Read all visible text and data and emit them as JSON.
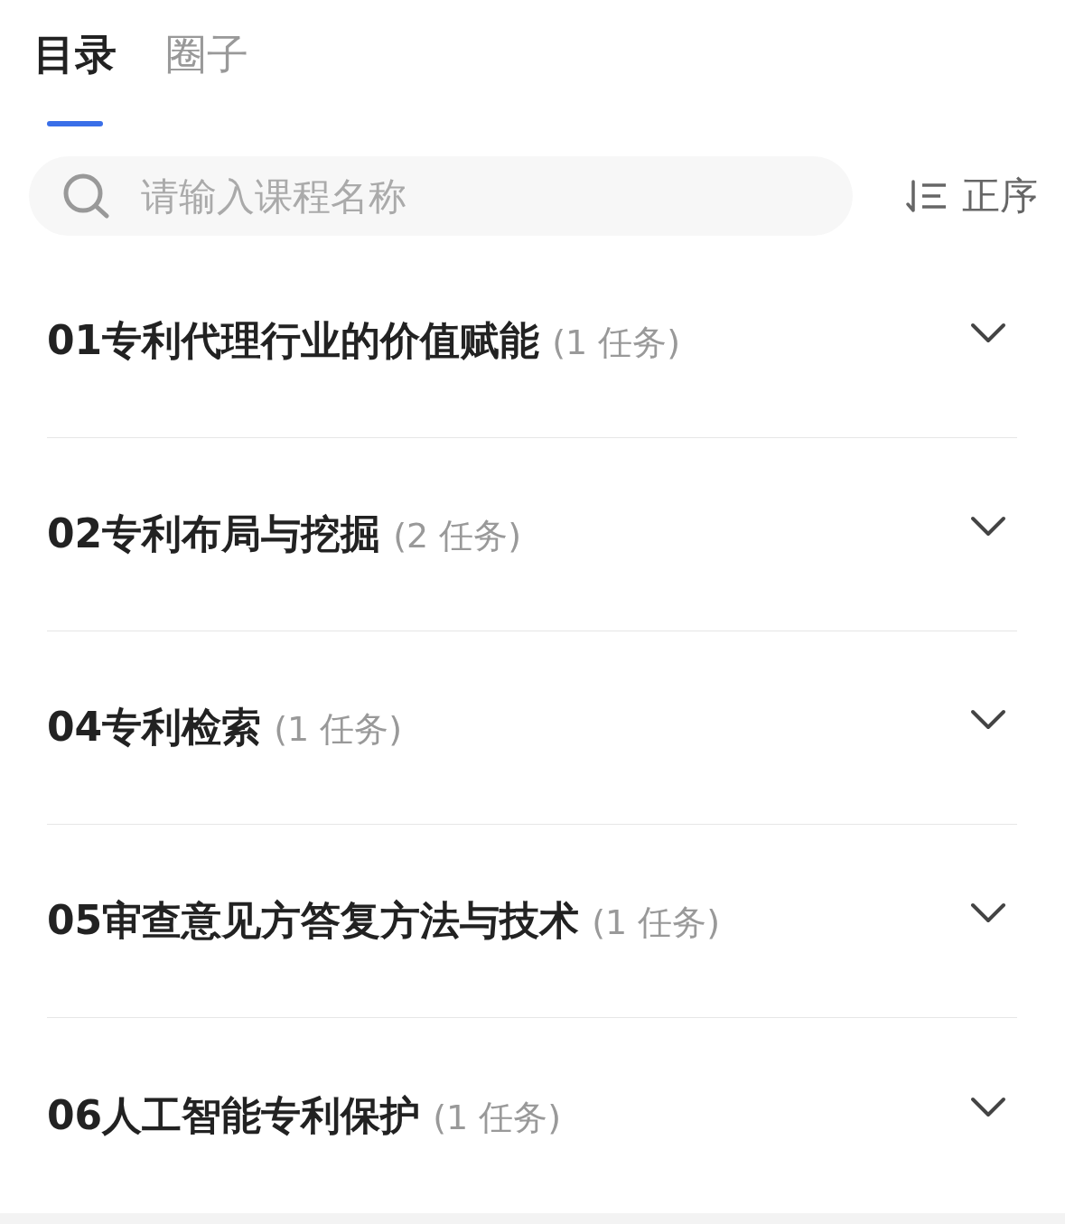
{
  "tabs": [
    {
      "label": "目录",
      "selected": true
    },
    {
      "label": "圈子",
      "selected": false
    }
  ],
  "search": {
    "placeholder": "请输入课程名称"
  },
  "sort": {
    "label": "正序"
  },
  "chapters": [
    {
      "title": "01专利代理行业的价值赋能",
      "count": "(1 任务)",
      "expanded": false
    },
    {
      "title": "02专利布局与挖掘",
      "count": "(2 任务)",
      "expanded": false
    },
    {
      "title": "04专利检索",
      "count": "(1 任务)",
      "expanded": false
    },
    {
      "title": "05审查意见方答复方法与技术",
      "count": "(1 任务)",
      "expanded": false
    },
    {
      "title": "06人工智能专利保护",
      "count": "(1 任务)",
      "expanded": false
    }
  ]
}
